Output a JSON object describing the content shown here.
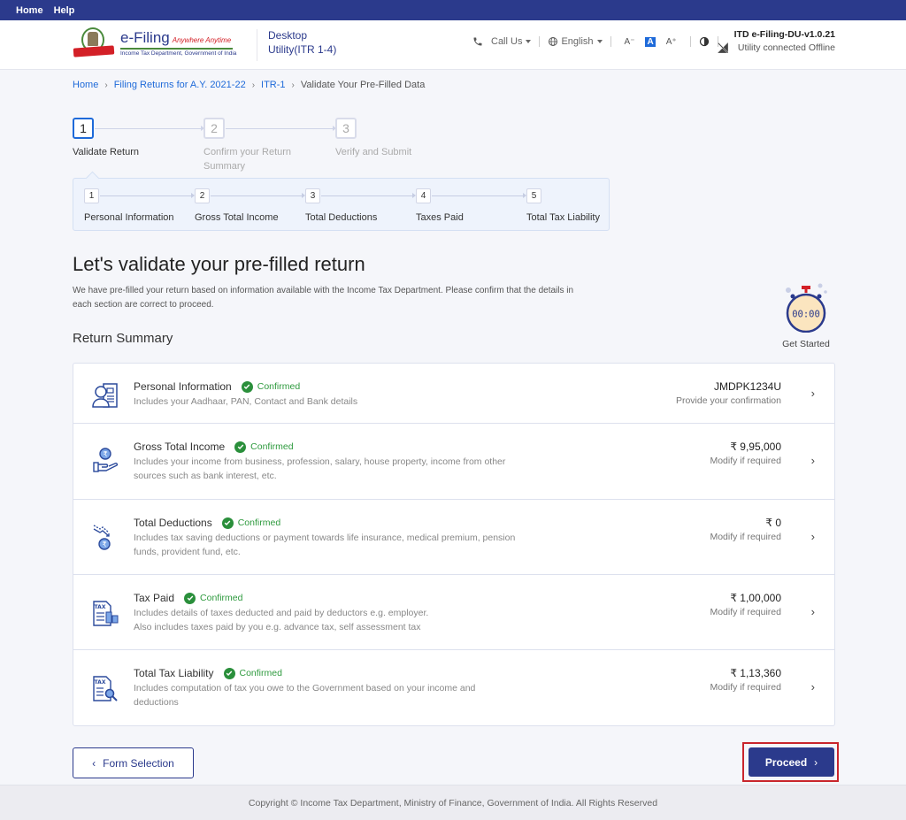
{
  "topnav": {
    "items": [
      "Home",
      "Help"
    ]
  },
  "header": {
    "logo_title": "e-Filing",
    "logo_tagline": "Anywhere Anytime",
    "logo_subtitle": "Income Tax Department, Government of India",
    "app_title_line1": "Desktop",
    "app_title_line2": "Utility(ITR 1-4)",
    "call_us": "Call Us",
    "language": "English",
    "font_decrease": "A⁻",
    "font_normal": "A",
    "font_increase": "A⁺",
    "version": "ITD e-Filing-DU-v1.0.21",
    "connection_status": "Utility connected Offline"
  },
  "breadcrumb": [
    "Home",
    "Filing Returns for A.Y. 2021-22",
    "ITR-1",
    "Validate Your Pre-Filled Data"
  ],
  "stepper": {
    "steps": [
      {
        "num": "1",
        "label": "Validate Return",
        "active": true
      },
      {
        "num": "2",
        "label": "Confirm your Return Summary",
        "active": false
      },
      {
        "num": "3",
        "label": "Verify and Submit",
        "active": false
      }
    ],
    "substeps": [
      {
        "num": "1",
        "label": "Personal Information"
      },
      {
        "num": "2",
        "label": "Gross Total Income"
      },
      {
        "num": "3",
        "label": "Total Deductions"
      },
      {
        "num": "4",
        "label": "Taxes Paid"
      },
      {
        "num": "5",
        "label": "Total Tax Liability"
      }
    ]
  },
  "main": {
    "title": "Let's validate your pre-filled return",
    "intro": "We have pre-filled your return based on information available with the Income Tax Department. Please confirm that the details in each section are correct to proceed.",
    "section_title": "Return Summary",
    "get_started": {
      "timer": "00:00",
      "label": "Get Started"
    }
  },
  "summary": [
    {
      "title": "Personal Information",
      "status": "Confirmed",
      "desc": "Includes your Aadhaar, PAN, Contact and Bank details",
      "value": "JMDPK1234U",
      "sub": "Provide your confirmation",
      "icon": "person-id-icon"
    },
    {
      "title": "Gross Total Income",
      "status": "Confirmed",
      "desc": "Includes your income from business, profession, salary, house property, income from other sources such as bank interest, etc.",
      "value": "₹ 9,95,000",
      "sub": "Modify if required",
      "icon": "rupee-hand-icon"
    },
    {
      "title": "Total Deductions",
      "status": "Confirmed",
      "desc": "Includes tax saving deductions or payment towards life insurance, medical premium, pension funds, provident fund, etc.",
      "value": "₹ 0",
      "sub": "Modify if required",
      "icon": "rupee-down-icon"
    },
    {
      "title": "Tax Paid",
      "status": "Confirmed",
      "desc": "Includes details of taxes deducted and paid by deductors e.g. employer. Also includes taxes paid by you e.g. advance tax, self assessment tax",
      "value": "₹ 1,00,000",
      "sub": "Modify if required",
      "icon": "tax-document-icon"
    },
    {
      "title": "Total Tax Liability",
      "status": "Confirmed",
      "desc": "Includes computation of tax you owe to the Government based on your income and deductions",
      "value": "₹ 1,13,360",
      "sub": "Modify if required",
      "icon": "tax-search-icon"
    }
  ],
  "buttons": {
    "back": "Form Selection",
    "proceed": "Proceed"
  },
  "footer": {
    "copyright": "Copyright © Income Tax Department, Ministry of Finance, Government of India. All Rights Reserved"
  },
  "colors": {
    "brand": "#2b3a8c",
    "link": "#1e6ad9",
    "confirmed": "#2e9a3e",
    "highlight": "#c9252c"
  }
}
